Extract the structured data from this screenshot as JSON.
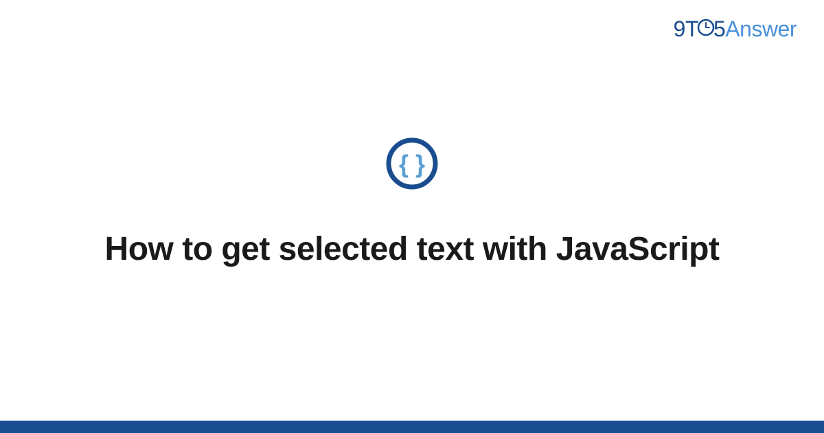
{
  "logo": {
    "part1": "9T",
    "part2": "5",
    "part3": "Answer"
  },
  "icon": {
    "name": "code-braces"
  },
  "title": "How to get selected text with JavaScript",
  "colors": {
    "brand_dark": "#1a4d8f",
    "brand_light": "#4a90d9",
    "text": "#1a1a1a"
  }
}
